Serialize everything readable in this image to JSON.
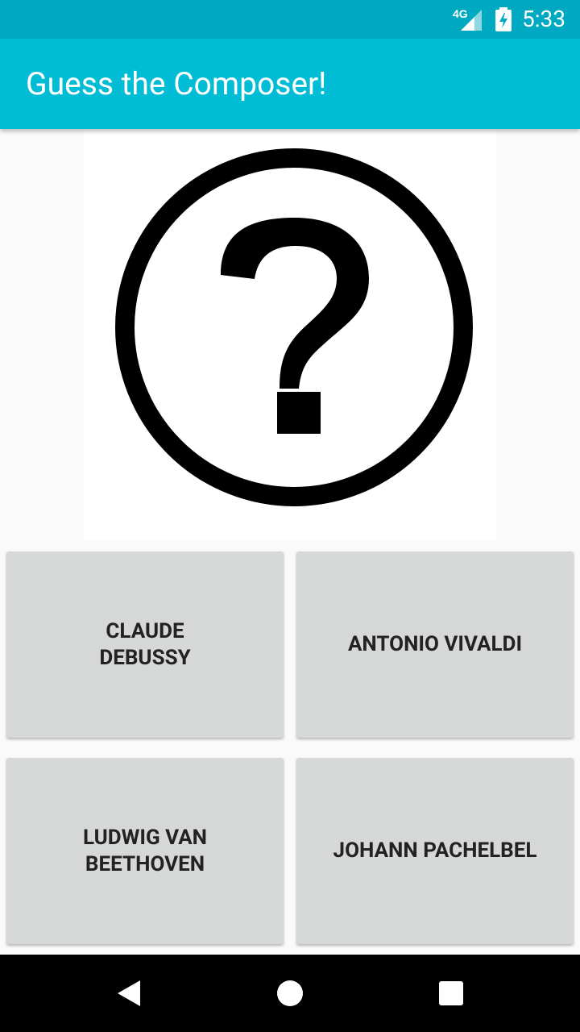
{
  "status_bar": {
    "network_label": "4G",
    "time": "5:33",
    "icons": [
      "signal-icon",
      "battery-charging-icon"
    ]
  },
  "app_bar": {
    "title": "Guess the Composer!"
  },
  "quiz": {
    "image_icon": "question-mark-circle-icon",
    "answers": [
      {
        "label": "CLAUDE DEBUSSY"
      },
      {
        "label": "ANTONIO VIVALDI"
      },
      {
        "label": "LUDWIG VAN BEETHOVEN"
      },
      {
        "label": "JOHANN PACHELBEL"
      }
    ]
  },
  "nav_bar": {
    "icons": [
      "back-icon",
      "home-icon",
      "recent-apps-icon"
    ]
  },
  "colors": {
    "status_bar": "#00a9c2",
    "app_bar": "#00bcd4",
    "button_bg": "#d6d7d7",
    "button_text": "#222222",
    "nav_bar": "#000000"
  }
}
